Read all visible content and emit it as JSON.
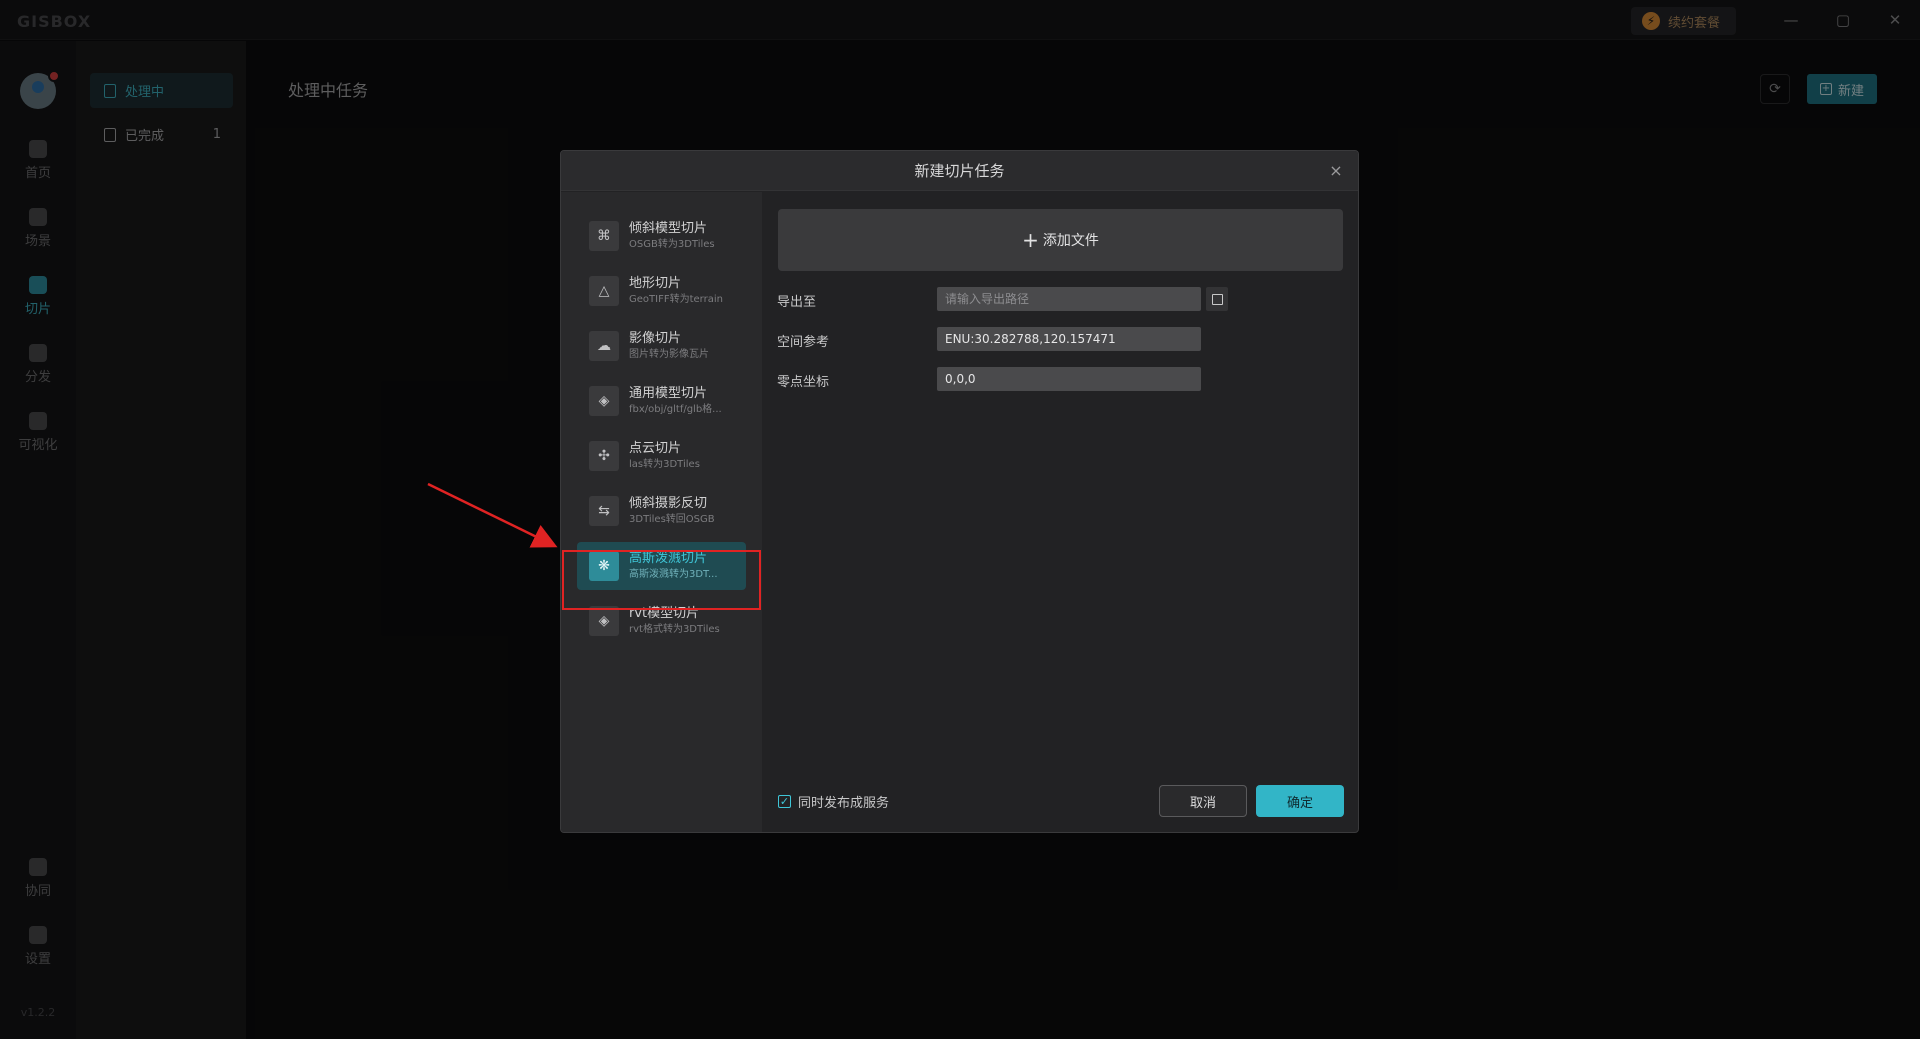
{
  "app": {
    "logo": "GISBOX",
    "plan_label": "续约套餐",
    "win_minimize": "—",
    "win_maximize": "▢",
    "win_close": "✕",
    "version": "v1.2.2"
  },
  "rail": {
    "items": [
      {
        "label": "首页",
        "icon": "home-icon"
      },
      {
        "label": "场景",
        "icon": "cube-icon"
      },
      {
        "label": "切片",
        "icon": "slice-icon"
      },
      {
        "label": "分发",
        "icon": "share-icon"
      },
      {
        "label": "可视化",
        "icon": "visualize-icon"
      },
      {
        "label": "协同",
        "icon": "lock-icon"
      },
      {
        "label": "设置",
        "icon": "gear-icon"
      }
    ]
  },
  "sidebar": {
    "items": [
      {
        "label": "处理中",
        "count": ""
      },
      {
        "label": "已完成",
        "count": "1"
      }
    ]
  },
  "main": {
    "title": "处理中任务",
    "new_label": "新建"
  },
  "modal": {
    "title": "新建切片任务",
    "close": "×",
    "types": [
      {
        "name": "倾斜模型切片",
        "desc": "OSGB转为3DTiles",
        "icon": "network-icon"
      },
      {
        "name": "地形切片",
        "desc": "GeoTIFF转为terrain",
        "icon": "mountain-icon"
      },
      {
        "name": "影像切片",
        "desc": "图片转为影像瓦片",
        "icon": "image-icon"
      },
      {
        "name": "通用模型切片",
        "desc": "fbx/obj/gltf/glb格...",
        "icon": "box-icon"
      },
      {
        "name": "点云切片",
        "desc": "las转为3DTiles",
        "icon": "pointcloud-icon"
      },
      {
        "name": "倾斜摄影反切",
        "desc": "3DTiles转回OSGB",
        "icon": "reverse-icon"
      },
      {
        "name": "高斯泼溅切片",
        "desc": "高斯泼溅转为3DT...",
        "icon": "gaussian-icon"
      },
      {
        "name": "rvt模型切片",
        "desc": "rvt格式转为3DTiles",
        "icon": "rvt-box-icon"
      }
    ],
    "add_file": "添加文件",
    "export_label": "导出至",
    "export_placeholder": "请输入导出路径",
    "spatial_label": "空间参考",
    "spatial_value": "ENU:30.282788,120.157471",
    "origin_label": "零点坐标",
    "origin_value": "0,0,0",
    "publish_label": "同时发布成服务",
    "publish_checked": true,
    "cancel": "取消",
    "ok": "确定"
  },
  "annotation": {
    "color": "#e02323"
  }
}
